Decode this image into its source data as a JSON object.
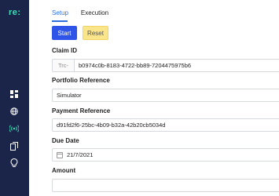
{
  "brand": {
    "logo_text": "re:"
  },
  "sidebar": {
    "icons": [
      "dashboard-icon",
      "globe-icon",
      "broadcast-icon",
      "copy-icon",
      "lightbulb-icon"
    ]
  },
  "tabs": [
    {
      "label": "Setup",
      "active": true
    },
    {
      "label": "Execution",
      "active": false
    }
  ],
  "actions": {
    "start_label": "Start",
    "reset_label": "Reset"
  },
  "form": {
    "claim_id": {
      "label": "Claim ID",
      "prefix": "Trc-",
      "value": "b0974c0b-8183-4722-bb89-7204475975b6"
    },
    "portfolio_reference": {
      "label": "Portfolio Reference",
      "value": "Simulator"
    },
    "payment_reference": {
      "label": "Payment Reference",
      "value": "d91fd2f6-25bc-4b09-b32a-42b20cb5034d"
    },
    "due_date": {
      "label": "Due Date",
      "value": "21/7/2021"
    },
    "amount": {
      "label": "Amount",
      "value": ""
    }
  },
  "colors": {
    "sidebar_bg": "#1a2549",
    "brand_accent": "#3ee0b8",
    "primary": "#2f55e8",
    "reset": "#fbe58a",
    "tab_active": "#2e6fe0"
  }
}
